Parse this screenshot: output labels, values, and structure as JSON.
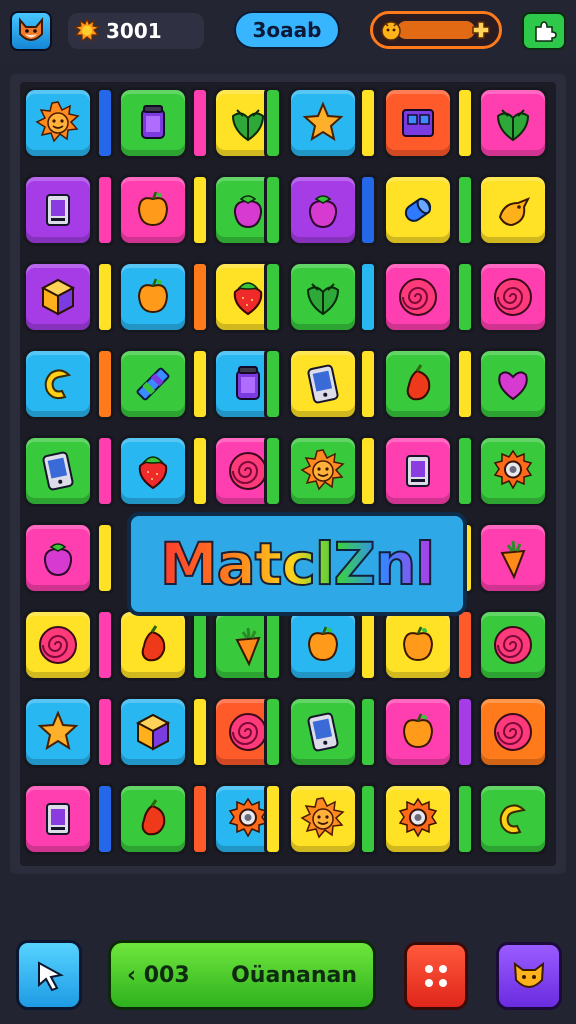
{
  "header": {
    "coins_value": "3001",
    "score_label": "3oaab",
    "avatar_icon": "fox-face-icon",
    "coin_icon": "sun-coin-icon",
    "powerup_icon": "orange-creature-icon",
    "plus_icon": "puzzle-plus-icon"
  },
  "board": {
    "title": "MatclZnl",
    "columns": 6,
    "rows": 9,
    "tiles": [
      {
        "color": "#29b7f2",
        "icon": "sun-icon"
      },
      {
        "color": "#38c93c",
        "icon": "jar-icon"
      },
      {
        "color": "#ffe125",
        "icon": "leaf-icon"
      },
      {
        "color": "#29b7f2",
        "icon": "star-icon"
      },
      {
        "color": "#ff5a2a",
        "icon": "cube-icon"
      },
      {
        "color": "#ff3fb0",
        "icon": "leaf-icon"
      },
      {
        "color": "#a53ce6",
        "icon": "card-icon"
      },
      {
        "color": "#ff3fb0",
        "icon": "apple-icon"
      },
      {
        "color": "#38c93c",
        "icon": "berry-icon"
      },
      {
        "color": "#a53ce6",
        "icon": "berry-icon"
      },
      {
        "color": "#ffe125",
        "icon": "cylinder-icon"
      },
      {
        "color": "#ffe125",
        "icon": "bird-icon"
      },
      {
        "color": "#a53ce6",
        "icon": "box-icon"
      },
      {
        "color": "#29b7f2",
        "icon": "apple-icon"
      },
      {
        "color": "#ffe125",
        "icon": "strawberry-icon"
      },
      {
        "color": "#38c93c",
        "icon": "leaf-icon"
      },
      {
        "color": "#ff3fb0",
        "icon": "spiral-icon"
      },
      {
        "color": "#ff3fb0",
        "icon": "spiral-icon"
      },
      {
        "color": "#29b7f2",
        "icon": "crescent-icon"
      },
      {
        "color": "#38c93c",
        "icon": "pencil-icon"
      },
      {
        "color": "#29b7f2",
        "icon": "jar-icon"
      },
      {
        "color": "#ffe125",
        "icon": "phone-icon"
      },
      {
        "color": "#38c93c",
        "icon": "pepper-icon"
      },
      {
        "color": "#38c93c",
        "icon": "heart-icon"
      },
      {
        "color": "#38c93c",
        "icon": "phone-icon"
      },
      {
        "color": "#29b7f2",
        "icon": "strawberry-icon"
      },
      {
        "color": "#ff3fb0",
        "icon": "spiral-icon"
      },
      {
        "color": "#38c93c",
        "icon": "sun-icon"
      },
      {
        "color": "#ff3fb0",
        "icon": "card-icon"
      },
      {
        "color": "#38c93c",
        "icon": "gear-icon"
      },
      {
        "color": "#ff3fb0",
        "icon": "berry-icon"
      },
      {
        "color": "#29b7f2",
        "icon": "none"
      },
      {
        "color": "#29b7f2",
        "icon": "none"
      },
      {
        "color": "#29b7f2",
        "icon": "none"
      },
      {
        "color": "#29b7f2",
        "icon": "none"
      },
      {
        "color": "#ff3fb0",
        "icon": "carrot-icon"
      },
      {
        "color": "#ffe125",
        "icon": "spiral-icon"
      },
      {
        "color": "#ffe125",
        "icon": "pepper-icon"
      },
      {
        "color": "#38c93c",
        "icon": "carrot-icon"
      },
      {
        "color": "#29b7f2",
        "icon": "apple-icon"
      },
      {
        "color": "#ffe125",
        "icon": "apple-icon"
      },
      {
        "color": "#38c93c",
        "icon": "spiral-icon"
      },
      {
        "color": "#29b7f2",
        "icon": "star-icon"
      },
      {
        "color": "#29b7f2",
        "icon": "box-icon"
      },
      {
        "color": "#ff5a2a",
        "icon": "spiral-icon"
      },
      {
        "color": "#38c93c",
        "icon": "phone-icon"
      },
      {
        "color": "#ff3fb0",
        "icon": "apple-icon"
      },
      {
        "color": "#ff7a1a",
        "icon": "spiral-icon"
      },
      {
        "color": "#ff3fb0",
        "icon": "card-icon"
      },
      {
        "color": "#38c93c",
        "icon": "pepper-icon"
      },
      {
        "color": "#29b7f2",
        "icon": "gear-icon"
      },
      {
        "color": "#ffe125",
        "icon": "sun-icon"
      },
      {
        "color": "#ffe125",
        "icon": "gear-icon"
      },
      {
        "color": "#38c93c",
        "icon": "crescent-icon"
      }
    ],
    "slits": [
      [
        "#2467e8",
        "#ff3fb0",
        "#38c93c",
        "#ffe125",
        "#ffe125"
      ],
      [
        "#ff3fb0",
        "#ffe125",
        "#38c93c",
        "#2467e8",
        "#38c93c"
      ],
      [
        "#ffe125",
        "#ff7a1a",
        "#38c93c",
        "#29b7f2",
        "#38c93c"
      ],
      [
        "#ff7a1a",
        "#ffe125",
        "#38c93c",
        "#ffe125",
        "#ffe125"
      ],
      [
        "#ff3fb0",
        "#ffe125",
        "#38c93c",
        "#ffe125",
        "#38c93c"
      ],
      [
        "#ffe125",
        "#ffe125",
        "#ffe125",
        "#ffe125",
        "#ffe125"
      ],
      [
        "#ff3fb0",
        "#38c93c",
        "#38c93c",
        "#ffe125",
        "#ff5a2a"
      ],
      [
        "#ff3fb0",
        "#ffe125",
        "#38c93c",
        "#38c93c",
        "#a53ce6"
      ],
      [
        "#2467e8",
        "#ff5a2a",
        "#ffe125",
        "#38c93c",
        "#38c93c"
      ]
    ]
  },
  "footer": {
    "left_icon": "cursor-arrow-icon",
    "main_prefix": "‹ 003",
    "main_label": "Oüananan",
    "dice_icon": "dice-icon",
    "pack_icon": "fox-head-icon"
  }
}
